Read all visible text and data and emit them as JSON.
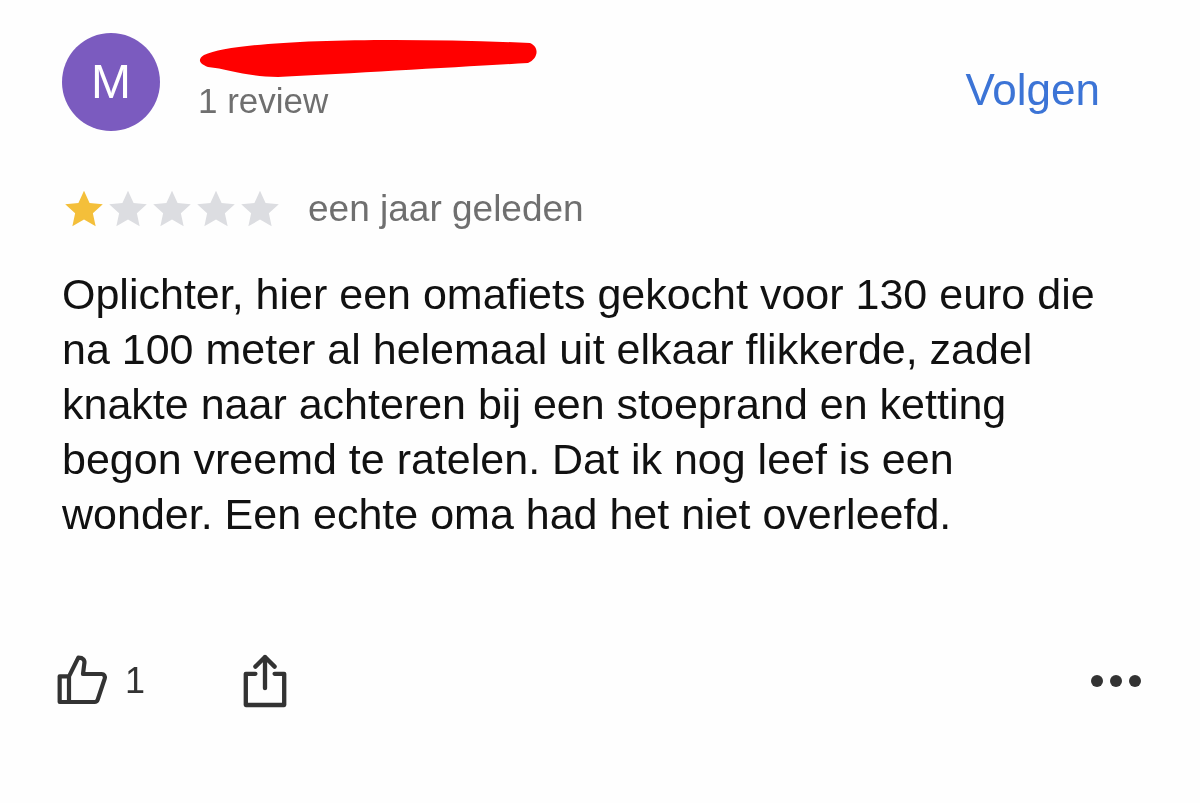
{
  "reviewer": {
    "avatar_letter": "M",
    "review_count": "1 review"
  },
  "follow_button": "Volgen",
  "rating": {
    "stars": 1,
    "time": "een jaar geleden"
  },
  "text": "Oplichter, hier een omafiets gekocht voor 130 euro die na 100 meter al helemaal uit elkaar flikkerde, zadel knakte naar achteren bij een stoeprand en ketting begon vreemd te ratelen. Dat ik nog leef is een wonder. Een echte oma had het niet overleefd.",
  "actions": {
    "likes": "1"
  }
}
